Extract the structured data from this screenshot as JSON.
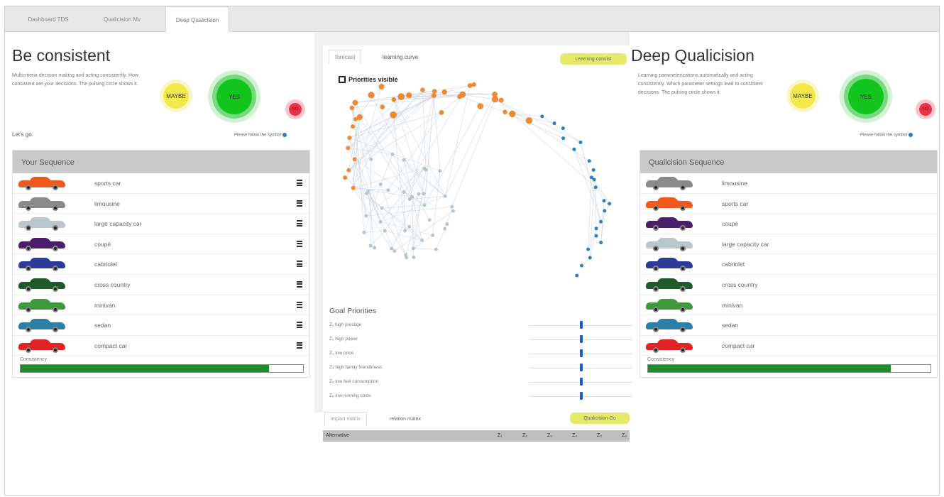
{
  "tabs": [
    {
      "label": "Dashboard TDS"
    },
    {
      "label": "Qualicision Mv"
    },
    {
      "label": "Deep Qualicision"
    }
  ],
  "left": {
    "title": "Be consistent",
    "desc": "Multicriteria decision making and acting consistently. How consistent are your decisions. The pulsing circle shows it.",
    "maybe": "MAYBE",
    "yes": "YES",
    "no": "NO",
    "letsgo": "Let's go.",
    "follow": "Please follow the symbol",
    "seq_title": "Your Sequence",
    "items": [
      {
        "name": "sports car",
        "color": "#ef5a1c"
      },
      {
        "name": "limousine",
        "color": "#8a8a8a"
      },
      {
        "name": "large capacity car",
        "color": "#b9c6cc"
      },
      {
        "name": "coupé",
        "color": "#4b1f6b"
      },
      {
        "name": "cabriolet",
        "color": "#2e3a9a"
      },
      {
        "name": "cross country",
        "color": "#1f5a2a"
      },
      {
        "name": "minivan",
        "color": "#3d9a3a"
      },
      {
        "name": "sedan",
        "color": "#2a7fa6"
      },
      {
        "name": "compact car",
        "color": "#e02424"
      }
    ],
    "consistency_label": "Consistency",
    "consistency": 0.88
  },
  "center": {
    "tab_forecast": "forecast",
    "tab_learning": "learning curve",
    "learning_btn": "Learning consist",
    "priorities": "Priorities visible",
    "goal_title": "Goal Priorities",
    "goals": [
      {
        "label": "Z₁ high prestige",
        "value": 0.5
      },
      {
        "label": "Z₂ high power",
        "value": 0.5
      },
      {
        "label": "Z₃ low price",
        "value": 0.5
      },
      {
        "label": "Z₄ high family friendliness",
        "value": 0.5
      },
      {
        "label": "Z₅ low fuel consumption",
        "value": 0.5
      },
      {
        "label": "Z₆ low running costs",
        "value": 0.5
      }
    ],
    "tab_impact": "impact matrix",
    "tab_relation": "relation matrix",
    "qualicision_btn": "Qualicision Go",
    "col_alternative": "Alternative",
    "cols": [
      "Z₁",
      "Z₂",
      "Z₃",
      "Z₄",
      "Z₅",
      "Z₆"
    ]
  },
  "right": {
    "title": "Deep Qualicision",
    "desc": "Learning parameterizations automatically and acting consistently. Which parameter settings lead to consistent decisions. The pulsing circle shows it.",
    "maybe": "MAYBE",
    "yes": "YES",
    "no": "NO",
    "follow": "Please follow the symbol",
    "seq_title": "Qualicision Sequence",
    "items": [
      {
        "name": "limousine",
        "color": "#8a8a8a"
      },
      {
        "name": "sports car",
        "color": "#ef5a1c"
      },
      {
        "name": "coupé",
        "color": "#4b1f6b"
      },
      {
        "name": "large capacity car",
        "color": "#b9c6cc"
      },
      {
        "name": "cabriolet",
        "color": "#2e3a9a"
      },
      {
        "name": "cross country",
        "color": "#1f5a2a"
      },
      {
        "name": "minivan",
        "color": "#3d9a3a"
      },
      {
        "name": "sedan",
        "color": "#2a7fa6"
      },
      {
        "name": "compact car",
        "color": "#e02424"
      }
    ],
    "consistency_label": "Consistency",
    "consistency": 0.86
  },
  "colors": {
    "orange_node": "#ee8a33",
    "blue_node": "#2a82c4",
    "gray_node": "#b8c4d3",
    "green": "#1f8c2b",
    "yellow": "#e6ea6b"
  }
}
